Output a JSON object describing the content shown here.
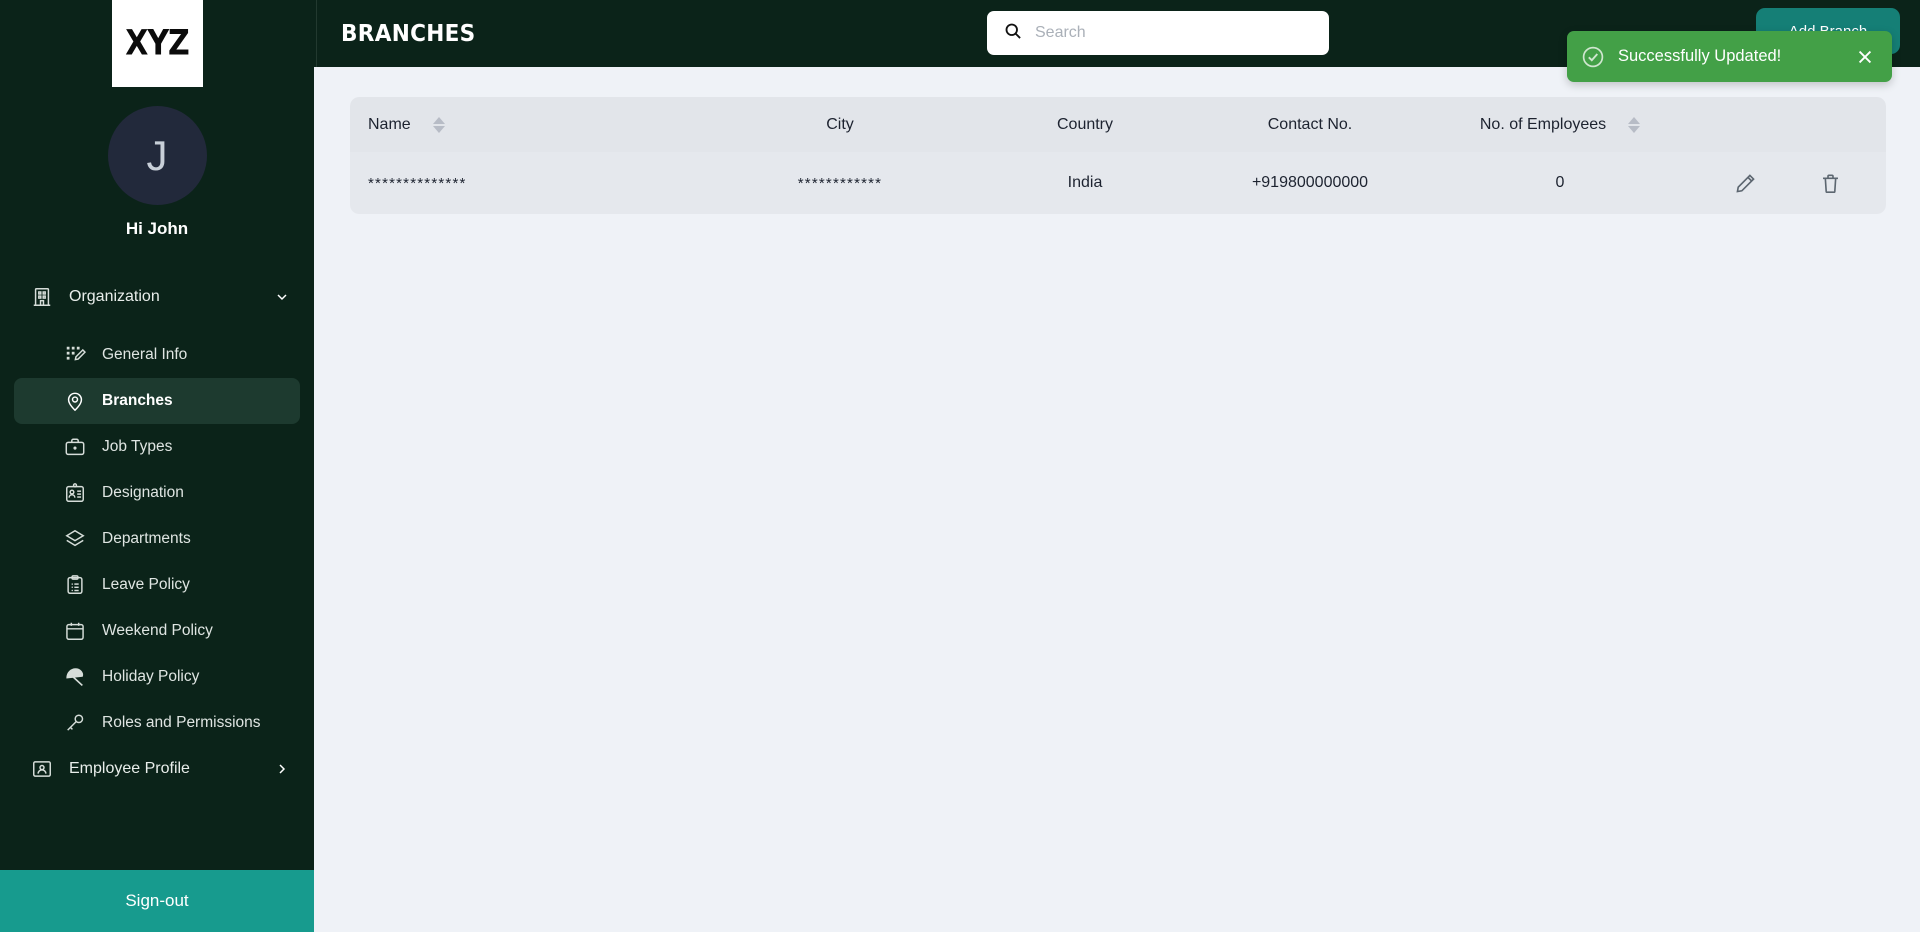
{
  "brand": {
    "logo_text": "XYZ"
  },
  "user": {
    "initial": "J",
    "greeting": "Hi John"
  },
  "sidebar": {
    "items": [
      {
        "label": "Organization",
        "icon": "building-icon",
        "level": "top",
        "chevron": "chevron-down-icon"
      },
      {
        "label": "General Info",
        "icon": "grid-edit-icon",
        "level": "sub"
      },
      {
        "label": "Branches",
        "icon": "map-pin-icon",
        "level": "sub",
        "active": true
      },
      {
        "label": "Job Types",
        "icon": "briefcase-icon",
        "level": "sub"
      },
      {
        "label": "Designation",
        "icon": "id-badge-icon",
        "level": "sub"
      },
      {
        "label": "Departments",
        "icon": "layers-icon",
        "level": "sub"
      },
      {
        "label": "Leave Policy",
        "icon": "clipboard-icon",
        "level": "sub"
      },
      {
        "label": "Weekend Policy",
        "icon": "calendar-icon",
        "level": "sub"
      },
      {
        "label": "Holiday Policy",
        "icon": "umbrella-icon",
        "level": "sub"
      },
      {
        "label": "Roles and Permissions",
        "icon": "key-icon",
        "level": "sub"
      },
      {
        "label": "Employee Profile",
        "icon": "user-card-icon",
        "level": "top",
        "chevron": "chevron-right-icon"
      }
    ],
    "signout_label": "Sign-out"
  },
  "topbar": {
    "menu_icon": "hamburger-icon",
    "title": "BRANCHES",
    "search": {
      "icon": "search-icon",
      "placeholder": "Search",
      "value": ""
    },
    "add_button_label": "Add Branch"
  },
  "toast": {
    "icon": "check-circle-icon",
    "message": "Successfully Updated!",
    "close_icon": "close-icon",
    "color": "#43a047"
  },
  "table": {
    "columns": [
      {
        "key": "name",
        "label": "Name",
        "sortable": true
      },
      {
        "key": "city",
        "label": "City",
        "sortable": false
      },
      {
        "key": "country",
        "label": "Country",
        "sortable": false
      },
      {
        "key": "contact",
        "label": "Contact No.",
        "sortable": false
      },
      {
        "key": "employees",
        "label": "No. of Employees",
        "sortable": true
      },
      {
        "key": "actions",
        "label": "",
        "sortable": false
      }
    ],
    "rows": [
      {
        "name": "**************",
        "city": "************",
        "country": "India",
        "contact": "+919800000000",
        "employees": "0",
        "edit_icon": "pencil-icon",
        "delete_icon": "trash-icon"
      }
    ]
  },
  "colors": {
    "sidebar_bg": "#0b2319",
    "accent_teal": "#179b8e",
    "button_teal": "#157f76",
    "toast_green": "#43a047",
    "page_bg": "#eff2f7",
    "table_header": "#e2e5ea",
    "table_row": "#e5e8ed"
  }
}
